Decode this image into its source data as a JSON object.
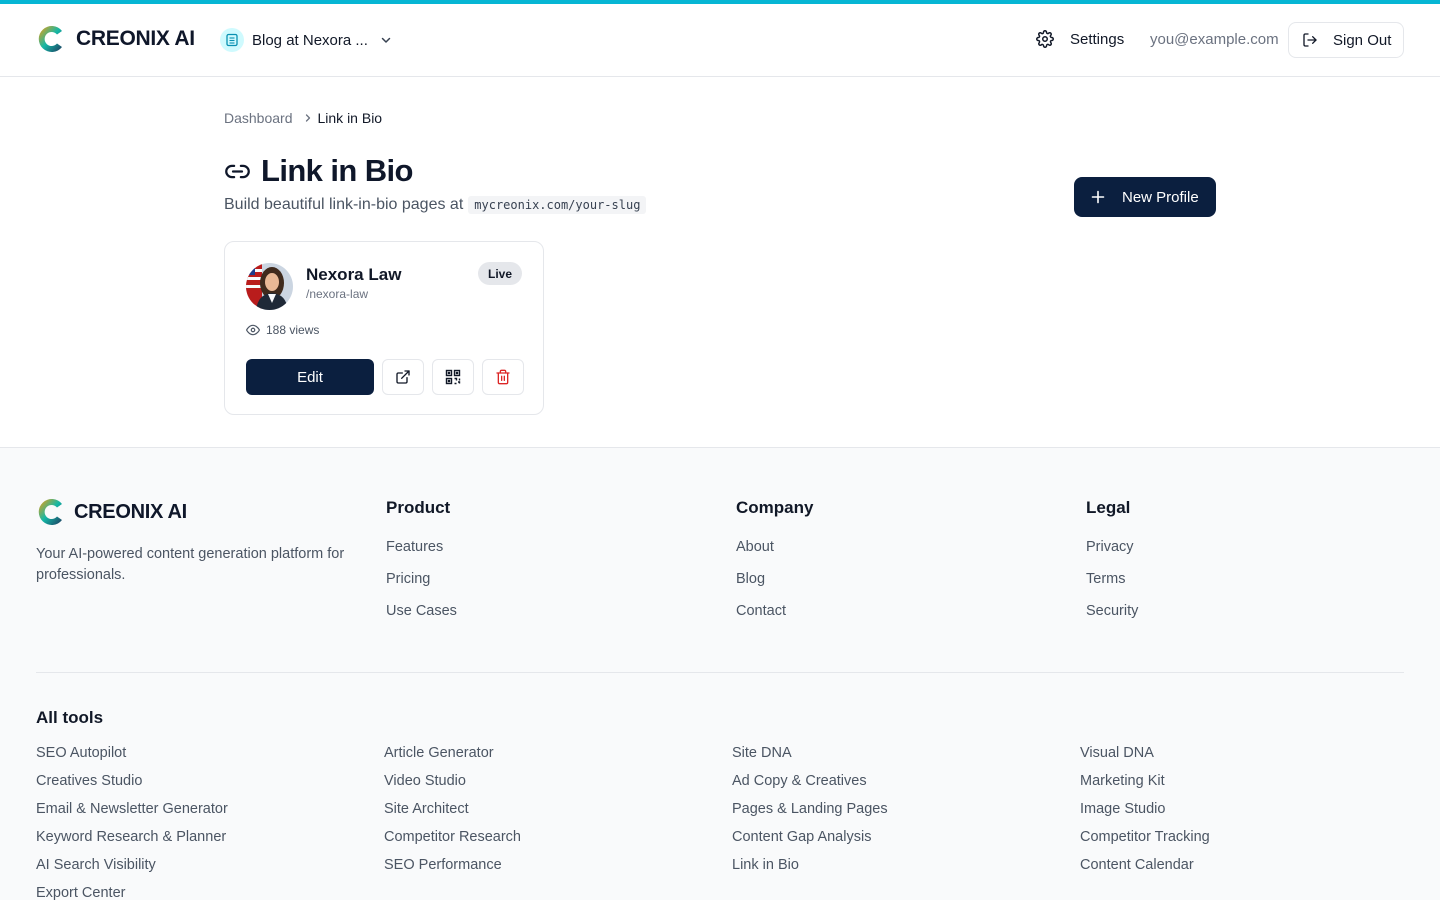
{
  "brand": {
    "name": "CREONIX AI",
    "accent": "#06b6d4",
    "primary": "#0b1f3f"
  },
  "header": {
    "site_label": "Blog at Nexora ...",
    "settings_label": "Settings",
    "user_email": "you@example.com",
    "signout_label": "Sign Out"
  },
  "breadcrumb": {
    "parent": "Dashboard",
    "current": "Link in Bio"
  },
  "page": {
    "title": "Link in Bio",
    "subtitle": "Build beautiful link-in-bio pages at",
    "subtitle_code": "mycreonix.com/your-slug",
    "new_button": "New Profile"
  },
  "profiles": [
    {
      "name": "Nexora Law",
      "slug": "/nexora-law",
      "status": "Live",
      "views": "188 views",
      "edit_label": "Edit"
    }
  ],
  "footer": {
    "tagline": "Your AI-powered content generation platform for professionals.",
    "columns": [
      {
        "title": "Product",
        "items": [
          "Features",
          "Pricing",
          "Use Cases"
        ]
      },
      {
        "title": "Company",
        "items": [
          "About",
          "Blog",
          "Contact"
        ]
      },
      {
        "title": "Legal",
        "items": [
          "Privacy",
          "Terms",
          "Security"
        ]
      }
    ],
    "tools_title": "All tools",
    "tools": [
      "SEO Autopilot",
      "Article Generator",
      "Site DNA",
      "Visual DNA",
      "Creatives Studio",
      "Video Studio",
      "Ad Copy & Creatives",
      "Marketing Kit",
      "Email & Newsletter Generator",
      "Site Architect",
      "Pages & Landing Pages",
      "Image Studio",
      "Keyword Research & Planner",
      "Competitor Research",
      "Content Gap Analysis",
      "Competitor Tracking",
      "AI Search Visibility",
      "SEO Performance",
      "Link in Bio",
      "Content Calendar",
      "Export Center"
    ]
  },
  "icons": {
    "logo": "creonix-logo-icon",
    "site": "building-icon",
    "settings": "gear-icon",
    "signout": "log-out-icon",
    "title": "link-icon",
    "new": "plus-icon",
    "views": "eye-icon",
    "open": "external-link-icon",
    "qr": "qr-code-icon",
    "delete": "trash-icon"
  }
}
